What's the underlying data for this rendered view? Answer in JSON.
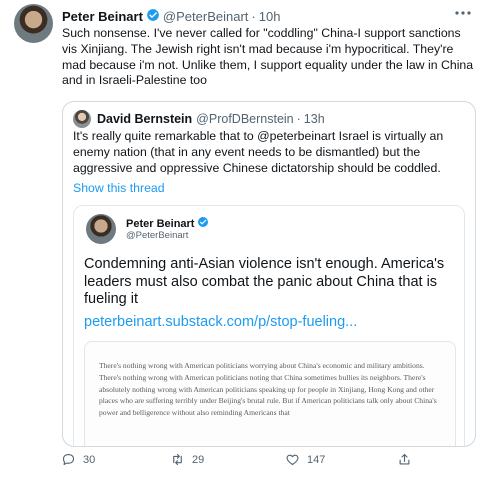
{
  "tweet": {
    "name": "Peter Beinart",
    "handle": "@PeterBeinart",
    "separator": "·",
    "time": "10h",
    "text": "Such nonsense. I've never called for \"coddling\" China-I support sanctions vis Xinjiang. The Jewish right isn't mad because i'm hypocritical. They're mad because i'm not. Unlike them, I support equality under the law in China and in Israeli-Palestine too"
  },
  "quote": {
    "name": "David Bernstein",
    "handle": "@ProfDBernstein",
    "separator": "·",
    "time": "13h",
    "text": "It's really quite remarkable that to @peterbeinart Israel is virtually an enemy nation (that in any event needs to be dismantled) but the aggressive and oppressive Chinese dictatorship should be coddled.",
    "show_thread": "Show this thread"
  },
  "inner_card": {
    "name": "Peter Beinart",
    "handle": "@PeterBeinart",
    "headline": "Condemning anti-Asian violence isn't enough. America's leaders must also combat the panic about China that is fueling it",
    "link": "peterbeinart.substack.com/p/stop-fueling...",
    "excerpt": "There's nothing wrong with American politicians worrying about China's economic and military ambitions. There's nothing wrong with American politicians noting that China sometimes bullies its neighbors. There's absolutely nothing wrong with American politicians speaking up for people in Xinjiang, Hong Kong and other places who are suffering terribly under Beijing's brutal rule. But if American politicians talk only about China's power and belligerence without also reminding Americans that"
  },
  "actions": {
    "reply_count": "30",
    "retweet_count": "29",
    "like_count": "147"
  },
  "colors": {
    "accent": "#1d9bf0",
    "text": "#0f1419",
    "secondary": "#536471",
    "border": "#cfd9de"
  },
  "icons": [
    "more-icon",
    "verified-badge-icon",
    "reply-icon",
    "retweet-icon",
    "like-icon",
    "share-icon"
  ]
}
